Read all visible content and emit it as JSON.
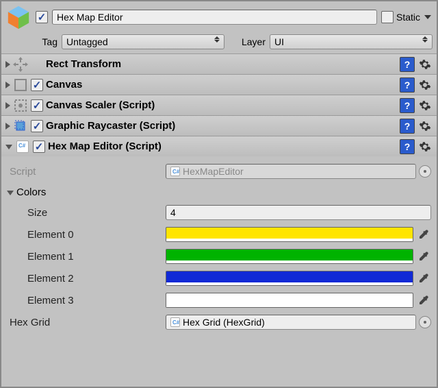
{
  "header": {
    "name": "Hex Map Editor",
    "enabled": true,
    "static_label": "Static",
    "static_checked": false
  },
  "tag_row": {
    "tag_label": "Tag",
    "tag_value": "Untagged",
    "layer_label": "Layer",
    "layer_value": "UI"
  },
  "components": [
    {
      "title": "Rect Transform",
      "checkbox": false,
      "expanded": false,
      "icon": "rect-transform"
    },
    {
      "title": "Canvas",
      "checkbox": true,
      "expanded": false,
      "icon": "canvas"
    },
    {
      "title": "Canvas Scaler (Script)",
      "checkbox": true,
      "expanded": false,
      "icon": "canvas-scaler"
    },
    {
      "title": "Graphic Raycaster (Script)",
      "checkbox": true,
      "expanded": false,
      "icon": "graphic-raycaster"
    },
    {
      "title": "Hex Map Editor (Script)",
      "checkbox": true,
      "expanded": true,
      "icon": "script"
    }
  ],
  "hex_editor": {
    "script_label": "Script",
    "script_value": "HexMapEditor",
    "colors_label": "Colors",
    "size_label": "Size",
    "size_value": "4",
    "elements": [
      {
        "label": "Element 0",
        "color": "#ffe500"
      },
      {
        "label": "Element 1",
        "color": "#00b300"
      },
      {
        "label": "Element 2",
        "color": "#1029d6"
      },
      {
        "label": "Element 3",
        "color": "#ffffff"
      }
    ],
    "hex_grid_label": "Hex Grid",
    "hex_grid_value": "Hex Grid (HexGrid)"
  }
}
